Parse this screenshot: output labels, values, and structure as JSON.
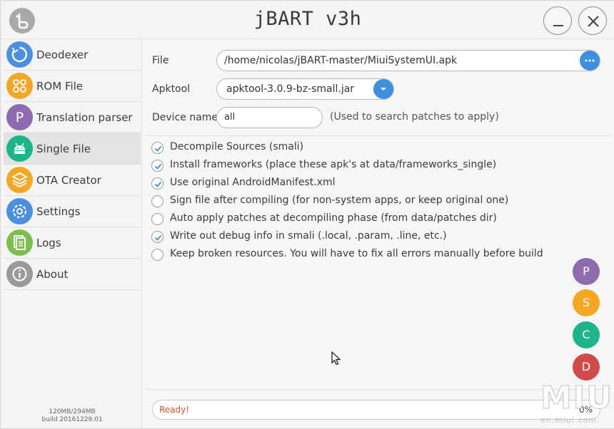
{
  "app": {
    "title": "jBART v3h"
  },
  "sidebar": {
    "items": [
      {
        "label": "Deodexer",
        "icon": "refresh-icon",
        "color": "#4a90e2"
      },
      {
        "label": "ROM File",
        "icon": "rom-file-icon",
        "color": "#f5a623"
      },
      {
        "label": "Translation parser",
        "icon": "p-letter-icon",
        "color": "#8e6bb0"
      },
      {
        "label": "Single File",
        "icon": "android-icon",
        "color": "#1fb58a"
      },
      {
        "label": "OTA Creator",
        "icon": "layers-icon",
        "color": "#f5a623"
      },
      {
        "label": "Settings",
        "icon": "gear-icon",
        "color": "#4a90e2"
      },
      {
        "label": "Logs",
        "icon": "logs-icon",
        "color": "#7cbf4b"
      },
      {
        "label": "About",
        "icon": "info-icon",
        "color": "#9a9a9a"
      }
    ],
    "active": "Single File",
    "memory": "120MB/294MB",
    "build": "build 20161229.01"
  },
  "form": {
    "file_label": "File",
    "file_value": "/home/nicolas/jBART-master/MiuiSystemUI.apk",
    "apktool_label": "Apktool",
    "apktool_value": "apktool-3.0.9-bz-small.jar",
    "device_label": "Device name",
    "device_value": "all",
    "device_hint": "(Used to search patches to apply)"
  },
  "options": [
    {
      "label": "Decompile Sources (smali)",
      "checked": true
    },
    {
      "label": "Install frameworks (place these apk's at data/frameworks_single)",
      "checked": true
    },
    {
      "label": "Use original AndroidManifest.xml",
      "checked": true
    },
    {
      "label": "Sign file after compiling (for non-system apps, or keep original one)",
      "checked": false
    },
    {
      "label": "Auto apply patches at decompiling phase (from data/patches dir)",
      "checked": false
    },
    {
      "label": "Write out debug info in smali (.local, .param, .line, etc.)",
      "checked": true
    },
    {
      "label": "Keep broken resources. You will have to fix all errors manually before build",
      "checked": false
    }
  ],
  "fabs": [
    {
      "letter": "P",
      "color": "#8e6bb0"
    },
    {
      "letter": "S",
      "color": "#f5a623"
    },
    {
      "letter": "C",
      "color": "#1fb58a"
    },
    {
      "letter": "D",
      "color": "#d14b4b"
    }
  ],
  "status": {
    "text": "Ready!",
    "percent": "0%",
    "progress": 0
  },
  "watermark": {
    "big": "MIUI",
    "small": "en.miui.com"
  }
}
